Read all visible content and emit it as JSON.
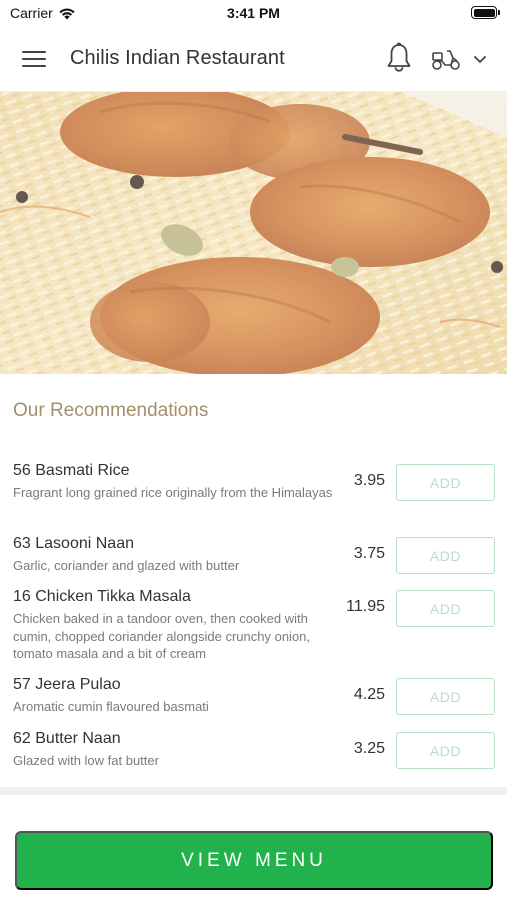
{
  "status_bar": {
    "carrier": "Carrier",
    "time": "3:41 PM",
    "battery_level": 1.0
  },
  "header": {
    "title": "Chilis Indian Restaurant",
    "icons": [
      "menu-icon",
      "bell-icon",
      "scooter-icon",
      "chevron-down-icon"
    ]
  },
  "recommendations": {
    "title": "Our Recommendations",
    "items": [
      {
        "name": "56 Basmati Rice",
        "description": "Fragrant long grained rice originally from the Himalayas",
        "price": "3.95",
        "add_label": "ADD"
      },
      {
        "name": "63 Lasooni Naan",
        "description": "Garlic, coriander and glazed with butter",
        "price": "3.75",
        "add_label": "ADD"
      },
      {
        "name": "16 Chicken Tikka Masala",
        "description": "Chicken baked in a tandoor oven, then cooked with cumin, chopped coriander alongside crunchy onion, tomato masala and a bit of cream",
        "price": "11.95",
        "add_label": "ADD"
      },
      {
        "name": "57 Jeera Pulao",
        "description": "Aromatic cumin flavoured basmati",
        "price": "4.25",
        "add_label": "ADD"
      },
      {
        "name": "62 Butter Naan",
        "description": "Glazed with low fat butter",
        "price": "3.25",
        "add_label": "ADD"
      }
    ]
  },
  "cta": {
    "label": "VIEW MENU"
  },
  "colors": {
    "accent_green": "#22b24c",
    "section_title": "#a38f6a",
    "add_border": "#b8e0c2"
  }
}
